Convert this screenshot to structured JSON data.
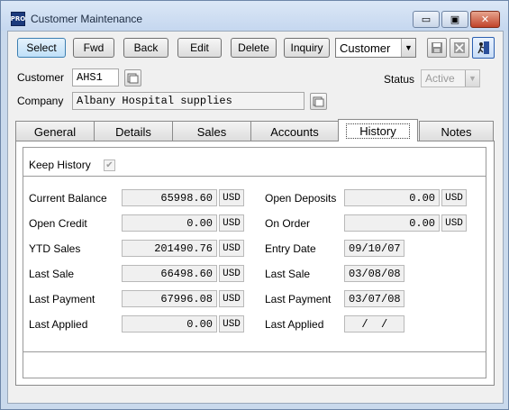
{
  "window": {
    "icon_text": "PRO",
    "title": "Customer Maintenance",
    "controls": {
      "minimize": "▭",
      "maximize": "▣",
      "close": "✕"
    }
  },
  "toolbar": {
    "buttons": [
      {
        "label": "Select",
        "active": true
      },
      {
        "label": "Fwd"
      },
      {
        "label": "Back"
      },
      {
        "label": "Edit"
      },
      {
        "label": "Delete"
      },
      {
        "label": "Inquiry"
      }
    ],
    "view_select": {
      "value": "Customer"
    },
    "icons": [
      "save-icon",
      "cancel-icon",
      "exit-icon"
    ]
  },
  "header": {
    "customer_label": "Customer",
    "customer_value": "AHS1",
    "company_label": "Company",
    "company_value": "Albany Hospital supplies",
    "status_label": "Status",
    "status_value": "Active"
  },
  "tabs": [
    "General",
    "Details",
    "Sales",
    "Accounts",
    "History",
    "Notes"
  ],
  "selected_tab": "History",
  "history": {
    "keep_history_label": "Keep History",
    "keep_history_checked": true,
    "left": [
      {
        "label": "Current Balance",
        "value": "65998.60",
        "currency": "USD"
      },
      {
        "label": "Open Credit",
        "value": "0.00",
        "currency": "USD"
      },
      {
        "label": "YTD Sales",
        "value": "201490.76",
        "currency": "USD"
      },
      {
        "label": "Last Sale",
        "value": "66498.60",
        "currency": "USD"
      },
      {
        "label": "Last Payment",
        "value": "67996.08",
        "currency": "USD"
      },
      {
        "label": "Last Applied",
        "value": "0.00",
        "currency": "USD"
      }
    ],
    "right": [
      {
        "label": "Open Deposits",
        "value": "0.00",
        "currency": "USD"
      },
      {
        "label": "On Order",
        "value": "0.00",
        "currency": "USD"
      },
      {
        "label": "Entry Date",
        "value": "09/10/07"
      },
      {
        "label": "Last Sale",
        "value": "03/08/08"
      },
      {
        "label": "Last Payment",
        "value": "03/07/08"
      },
      {
        "label": "Last Applied",
        "value": "  /  /"
      }
    ]
  }
}
